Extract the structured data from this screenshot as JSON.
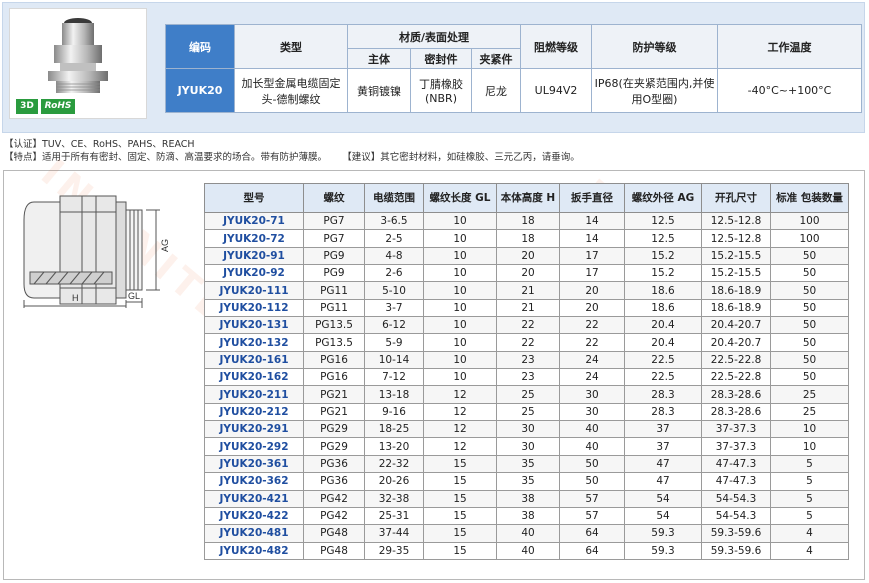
{
  "badges": {
    "three_d": "3D",
    "rohs": "RoHS"
  },
  "spec": {
    "headers": {
      "code": "编码",
      "type": "类型",
      "material": "材质/表面处理",
      "body": "主体",
      "seal": "密封件",
      "clamp": "夹紧件",
      "flame": "阻燃等级",
      "protect": "防护等级",
      "temp": "工作温度"
    },
    "row": {
      "code": "JYUK20",
      "type": "加长型金属电缆固定头-德制螺纹",
      "body": "黄铜镀镍",
      "seal": "丁腈橡胶(NBR)",
      "clamp": "尼龙",
      "flame": "UL94V2",
      "protect": "IP68(在夹紧范围内,并使用O型圈)",
      "temp": "-40°C~+100°C"
    }
  },
  "info": {
    "cert": "【认证】TUV、CE、RoHS、PAHS、REACH",
    "feature": "【特点】适用于所有有密封、固定、防滴、高温要求的场合。带有防护薄膜。",
    "advice": "【建议】其它密封材料，如硅橡胶、三元乙丙，请垂询。"
  },
  "drawing_labels": {
    "h": "H",
    "gl": "GL",
    "ag": "AG"
  },
  "table": {
    "headers": [
      "型号",
      "螺纹",
      "电缆范围",
      "螺纹长度 GL",
      "本体高度 H",
      "扳手直径",
      "螺纹外径 AG",
      "开孔尺寸",
      "标准 包装数量"
    ],
    "rows": [
      [
        "JYUK20-71",
        "PG7",
        "3-6.5",
        "10",
        "18",
        "14",
        "12.5",
        "12.5-12.8",
        "100"
      ],
      [
        "JYUK20-72",
        "PG7",
        "2-5",
        "10",
        "18",
        "14",
        "12.5",
        "12.5-12.8",
        "100"
      ],
      [
        "JYUK20-91",
        "PG9",
        "4-8",
        "10",
        "20",
        "17",
        "15.2",
        "15.2-15.5",
        "50"
      ],
      [
        "JYUK20-92",
        "PG9",
        "2-6",
        "10",
        "20",
        "17",
        "15.2",
        "15.2-15.5",
        "50"
      ],
      [
        "JYUK20-111",
        "PG11",
        "5-10",
        "10",
        "21",
        "20",
        "18.6",
        "18.6-18.9",
        "50"
      ],
      [
        "JYUK20-112",
        "PG11",
        "3-7",
        "10",
        "21",
        "20",
        "18.6",
        "18.6-18.9",
        "50"
      ],
      [
        "JYUK20-131",
        "PG13.5",
        "6-12",
        "10",
        "22",
        "22",
        "20.4",
        "20.4-20.7",
        "50"
      ],
      [
        "JYUK20-132",
        "PG13.5",
        "5-9",
        "10",
        "22",
        "22",
        "20.4",
        "20.4-20.7",
        "50"
      ],
      [
        "JYUK20-161",
        "PG16",
        "10-14",
        "10",
        "23",
        "24",
        "22.5",
        "22.5-22.8",
        "50"
      ],
      [
        "JYUK20-162",
        "PG16",
        "7-12",
        "10",
        "23",
        "24",
        "22.5",
        "22.5-22.8",
        "50"
      ],
      [
        "JYUK20-211",
        "PG21",
        "13-18",
        "12",
        "25",
        "30",
        "28.3",
        "28.3-28.6",
        "25"
      ],
      [
        "JYUK20-212",
        "PG21",
        "9-16",
        "12",
        "25",
        "30",
        "28.3",
        "28.3-28.6",
        "25"
      ],
      [
        "JYUK20-291",
        "PG29",
        "18-25",
        "12",
        "30",
        "40",
        "37",
        "37-37.3",
        "10"
      ],
      [
        "JYUK20-292",
        "PG29",
        "13-20",
        "12",
        "30",
        "40",
        "37",
        "37-37.3",
        "10"
      ],
      [
        "JYUK20-361",
        "PG36",
        "22-32",
        "15",
        "35",
        "50",
        "47",
        "47-47.3",
        "5"
      ],
      [
        "JYUK20-362",
        "PG36",
        "20-26",
        "15",
        "35",
        "50",
        "47",
        "47-47.3",
        "5"
      ],
      [
        "JYUK20-421",
        "PG42",
        "32-38",
        "15",
        "38",
        "57",
        "54",
        "54-54.3",
        "5"
      ],
      [
        "JYUK20-422",
        "PG42",
        "25-31",
        "15",
        "38",
        "57",
        "54",
        "54-54.3",
        "5"
      ],
      [
        "JYUK20-481",
        "PG48",
        "37-44",
        "15",
        "40",
        "64",
        "59.3",
        "59.3-59.6",
        "4"
      ],
      [
        "JYUK20-482",
        "PG48",
        "29-35",
        "15",
        "40",
        "64",
        "59.3",
        "59.3-59.6",
        "4"
      ]
    ]
  }
}
